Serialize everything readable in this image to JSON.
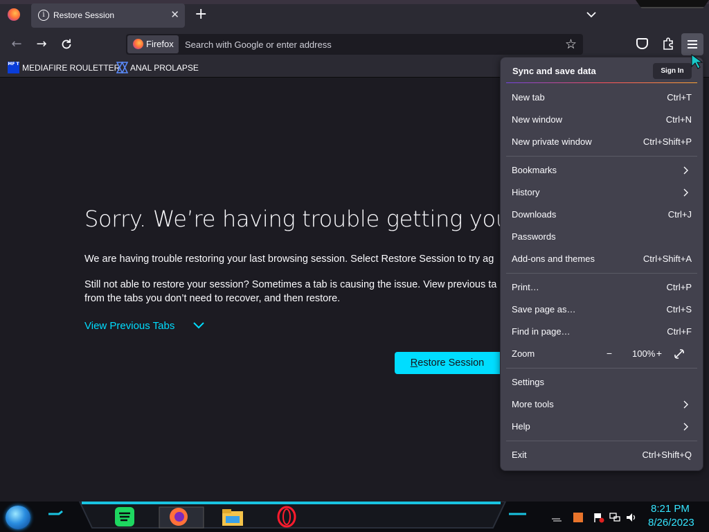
{
  "browser": {
    "tab_title": "Restore Session",
    "new_tab_symbol": "+",
    "urlbar_chip": "Firefox",
    "urlbar_placeholder": "Search with Google or enter address"
  },
  "bookmarks": [
    {
      "label": "MEDIAFIRE ROULETTER",
      "icon": "MF T"
    },
    {
      "label": "ANAL PROLAPSE"
    }
  ],
  "page": {
    "heading": "Sorry. We’re having trouble getting your pag",
    "para1": "We are having trouble restoring your last browsing session. Select Restore Session to try ag",
    "para2_line1": "Still not able to restore your session? Sometimes a tab is causing the issue. View previous ta",
    "para2_line2": "from the tabs you don’t need to recover, and then restore.",
    "view_previous": "View Previous Tabs",
    "restore_first": "R",
    "restore_rest": "estore Session"
  },
  "menu": {
    "sync_title": "Sync and save data",
    "sign_in": "Sign In",
    "items": [
      {
        "label": "New tab",
        "shortcut": "Ctrl+T"
      },
      {
        "label": "New window",
        "shortcut": "Ctrl+N"
      },
      {
        "label": "New private window",
        "shortcut": "Ctrl+Shift+P"
      },
      {
        "label": "Bookmarks",
        "shortcut": ""
      },
      {
        "label": "History",
        "shortcut": ""
      },
      {
        "label": "Downloads",
        "shortcut": "Ctrl+J"
      },
      {
        "label": "Passwords",
        "shortcut": ""
      },
      {
        "label": "Add-ons and themes",
        "shortcut": "Ctrl+Shift+A"
      },
      {
        "label": "Print…",
        "shortcut": "Ctrl+P"
      },
      {
        "label": "Save page as…",
        "shortcut": "Ctrl+S"
      },
      {
        "label": "Find in page…",
        "shortcut": "Ctrl+F"
      },
      {
        "label": "Zoom",
        "shortcut": ""
      },
      {
        "label": "Settings",
        "shortcut": ""
      },
      {
        "label": "More tools",
        "shortcut": ""
      },
      {
        "label": "Help",
        "shortcut": ""
      },
      {
        "label": "Exit",
        "shortcut": "Ctrl+Shift+Q"
      }
    ],
    "zoom_value": "100%",
    "zoom_minus": "−",
    "zoom_plus": "+"
  },
  "taskbar": {
    "time": "8:21 PM",
    "date": "8/26/2023"
  },
  "colors": {
    "accent_cyan": "#00ddff",
    "chrome_bg": "#2b2a33",
    "menu_bg": "#42414d",
    "page_bg": "#1c1b22"
  }
}
